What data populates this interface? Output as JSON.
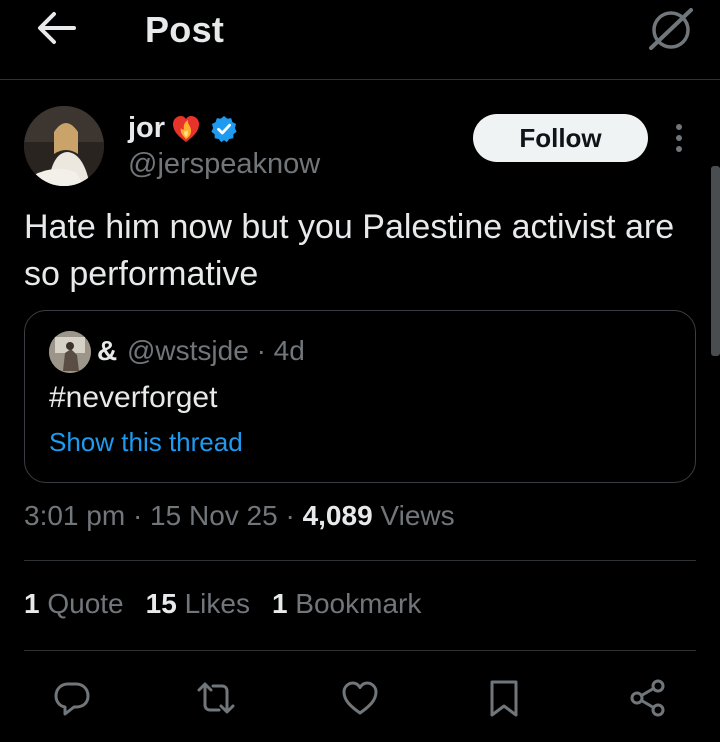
{
  "header": {
    "title": "Post"
  },
  "author": {
    "display_name": "jor",
    "handle": "@jerspeaknow",
    "follow_label": "Follow"
  },
  "tweet": {
    "text": "Hate him now but you Palestine activist are so performative"
  },
  "quote": {
    "display_name": "&",
    "handle_time": "@wstsjde · 4d",
    "text": "#neverforget",
    "thread_link": "Show this thread"
  },
  "meta": {
    "time_date": "3:01 pm · 15 Nov 25 · ",
    "views_count": "4,089",
    "views_label": " Views"
  },
  "stats": {
    "quotes_count": "1",
    "quotes_label": " Quote",
    "likes_count": "15",
    "likes_label": " Likes",
    "bookmarks_count": "1",
    "bookmarks_label": " Bookmark"
  },
  "colors": {
    "background": "#000000",
    "text_primary": "#e7e9ea",
    "text_secondary": "#71767b",
    "accent_link": "#1d9bf0",
    "verified_badge": "#1d9bf0",
    "divider": "#2f3336"
  },
  "icons": [
    "back-arrow-icon",
    "grok-icon",
    "verified-icon",
    "fire-heart-emoji",
    "more-icon",
    "reply-icon",
    "repost-icon",
    "like-icon",
    "bookmark-icon",
    "share-icon"
  ]
}
